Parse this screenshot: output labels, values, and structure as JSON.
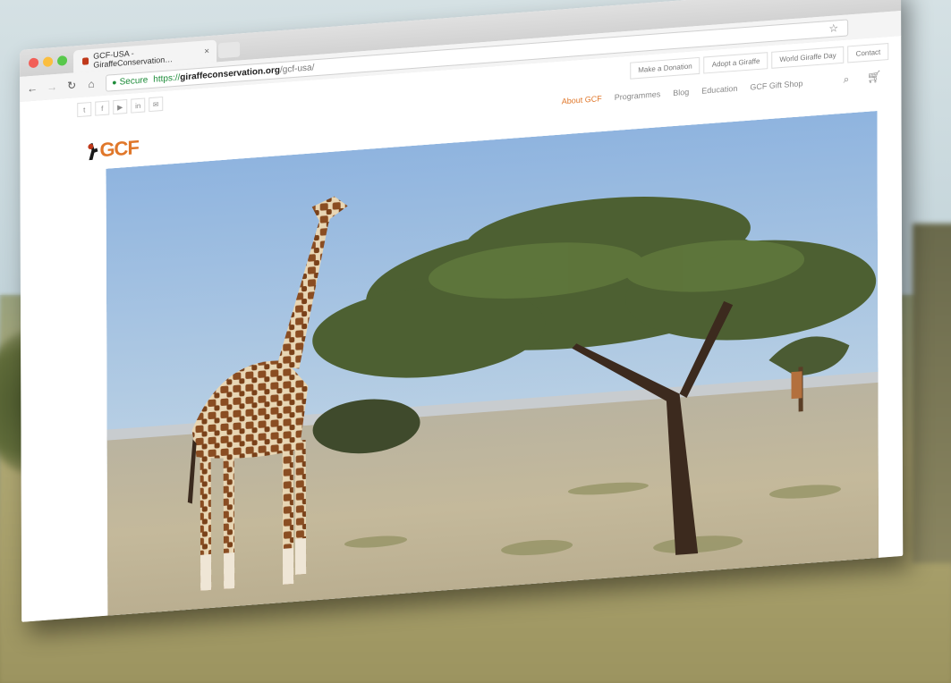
{
  "browser": {
    "tab_title": "GCF-USA - GiraffeConservation…",
    "tab_close": "×",
    "url_secure": "Secure",
    "url_protocol": "https://",
    "url_host": "giraffeconservation.org",
    "url_path": "/gcf-usa/"
  },
  "site": {
    "logo_text": "GCF",
    "utility_links": [
      "Make a Donation",
      "Adopt a Giraffe",
      "World Giraffe Day",
      "Contact"
    ],
    "main_nav": [
      "About GCF",
      "Programmes",
      "Blog",
      "Education",
      "GCF Gift Shop"
    ],
    "social_icons": [
      "twitter-icon",
      "facebook-icon",
      "youtube-icon",
      "linkedin-icon",
      "email-icon"
    ],
    "accent_color": "#e0772a"
  }
}
